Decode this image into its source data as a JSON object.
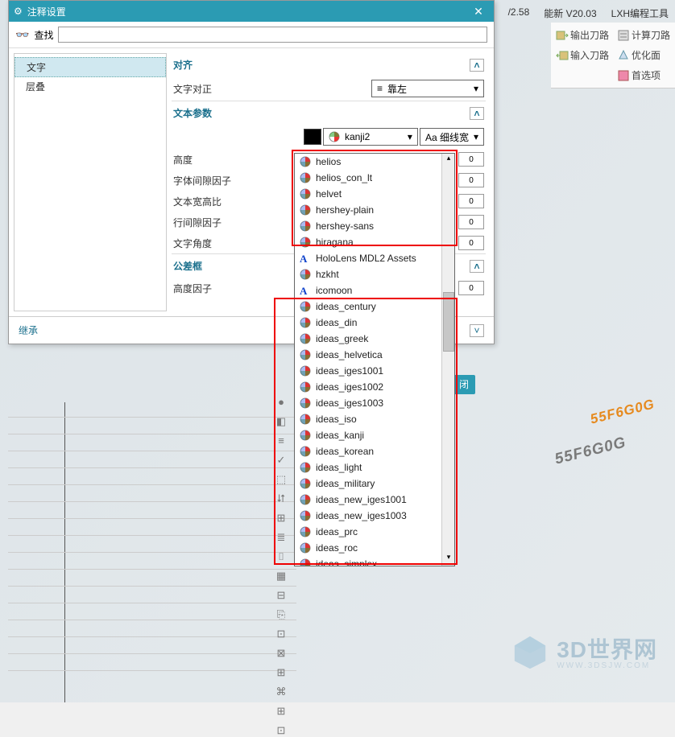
{
  "top": {
    "v": "/2.58",
    "nengxin": "能新 V20.03",
    "lxh": "LXH编程工具"
  },
  "ribbon": {
    "out_tool": "输出刀路",
    "in_tool": "输入刀路",
    "calc": "计算刀路",
    "optface": "优化面",
    "pref": "首选项"
  },
  "dialog": {
    "title": "注释设置",
    "search_label": "查找",
    "search_value": "",
    "categories": [
      "文字",
      "层叠"
    ],
    "sections": {
      "align": {
        "title": "对齐",
        "row_label": "文字对正",
        "align_value": "靠左"
      },
      "textparam": {
        "title": "文本参数",
        "font_selected": "kanji2",
        "weight": "Aa 细线宽",
        "rows": [
          "高度",
          "字体间隙因子",
          "文本宽高比",
          "行间隙因子",
          "文字角度"
        ],
        "stub": "0"
      },
      "tolbox": {
        "title": "公差框",
        "row": "高度因子"
      }
    },
    "inherit": "继承"
  },
  "font_list": [
    {
      "n": "helios",
      "t": "p"
    },
    {
      "n": "helios_con_lt",
      "t": "p"
    },
    {
      "n": "helvet",
      "t": "p"
    },
    {
      "n": "hershey-plain",
      "t": "p"
    },
    {
      "n": "hershey-sans",
      "t": "p"
    },
    {
      "n": "hiragana",
      "t": "p"
    },
    {
      "n": "HoloLens MDL2 Assets",
      "t": "a"
    },
    {
      "n": "hzkht",
      "t": "p"
    },
    {
      "n": "icomoon",
      "t": "a"
    },
    {
      "n": "ideas_century",
      "t": "p"
    },
    {
      "n": "ideas_din",
      "t": "p"
    },
    {
      "n": "ideas_greek",
      "t": "p"
    },
    {
      "n": "ideas_helvetica",
      "t": "p"
    },
    {
      "n": "ideas_iges1001",
      "t": "p"
    },
    {
      "n": "ideas_iges1002",
      "t": "p"
    },
    {
      "n": "ideas_iges1003",
      "t": "p"
    },
    {
      "n": "ideas_iso",
      "t": "p"
    },
    {
      "n": "ideas_kanji",
      "t": "p"
    },
    {
      "n": "ideas_korean",
      "t": "p"
    },
    {
      "n": "ideas_light",
      "t": "p"
    },
    {
      "n": "ideas_military",
      "t": "p"
    },
    {
      "n": "ideas_new_iges1001",
      "t": "p"
    },
    {
      "n": "ideas_new_iges1003",
      "t": "p"
    },
    {
      "n": "ideas_prc",
      "t": "p"
    },
    {
      "n": "ideas_roc",
      "t": "p"
    },
    {
      "n": "ideas_simplex",
      "t": "p"
    }
  ],
  "tool_icons": [
    "●",
    "◧",
    "≡",
    "✓",
    "⬚",
    "⮃",
    "⊞",
    "≣",
    "⌷",
    "▦",
    "⊟",
    "⎘",
    "⊡",
    "⊠",
    "⊞",
    "⌘",
    "⊞",
    "⊡"
  ],
  "close_btn": "闭",
  "watermark": {
    "code": "55F6G0G"
  },
  "brand": {
    "name": "3D世界网",
    "url": "WWW.3DSJW.COM"
  }
}
